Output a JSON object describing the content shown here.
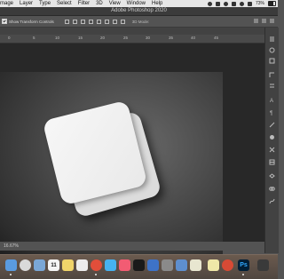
{
  "menubar": {
    "items": [
      "mage",
      "Layer",
      "Type",
      "Select",
      "Filter",
      "3D",
      "View",
      "Window",
      "Help"
    ],
    "battery_percent": "73%"
  },
  "titlebar": {
    "title": "Adobe Photoshop 2020"
  },
  "options": {
    "show_transform_controls": "Show Transform Controls",
    "mode_3d": "3D Mode:"
  },
  "ruler": {
    "ticks": [
      "0",
      "5",
      "10",
      "15",
      "20",
      "25",
      "30",
      "35",
      "40",
      "45"
    ]
  },
  "statusrow": {
    "zoom": "16.67%"
  },
  "dock": {
    "calendar_day": "11",
    "ps_label": "Ps"
  },
  "colors": {
    "menubar": "#e6e6e6",
    "workspace": "#535353",
    "canvas_bg": "#282828",
    "dock": "#5c4f45",
    "ps_blue": "#31a8ff"
  }
}
